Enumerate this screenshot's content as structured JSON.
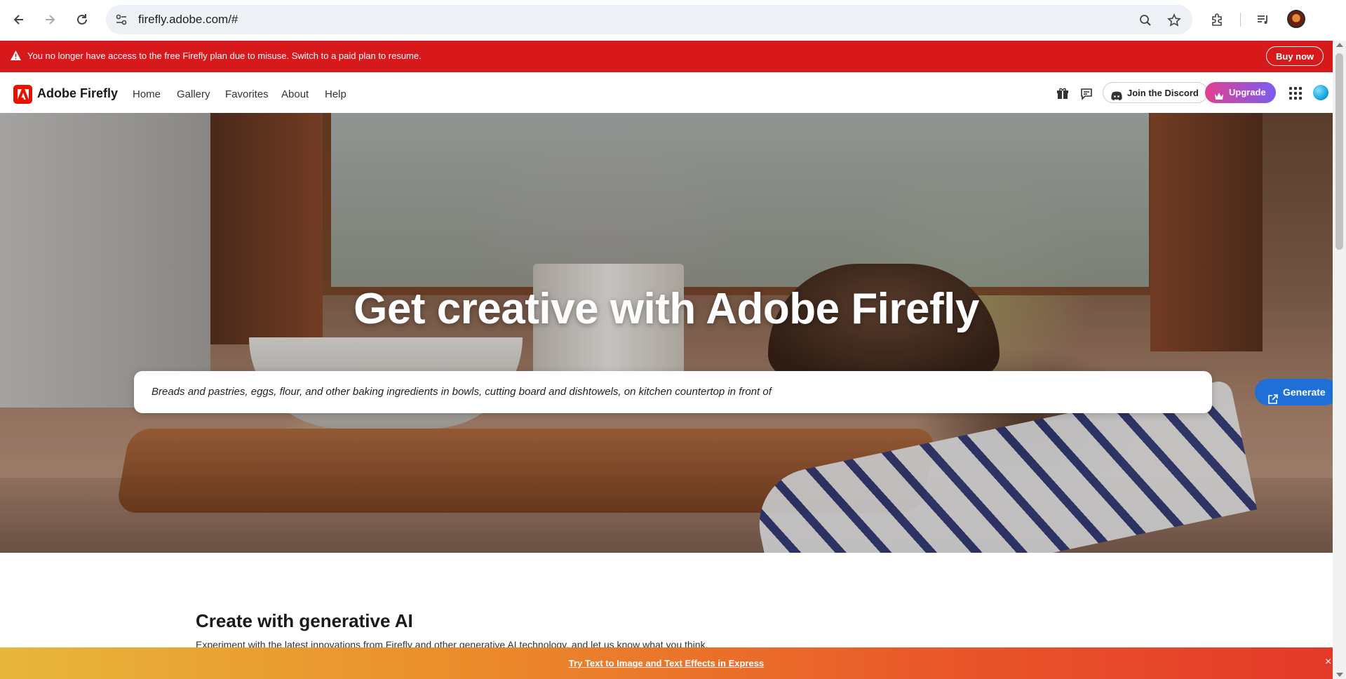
{
  "browser": {
    "url": "firefly.adobe.com/#",
    "icons": [
      "back-arrow-icon",
      "forward-arrow-icon",
      "reload-icon",
      "site-settings-icon",
      "zoom-icon",
      "bookmark-star-icon",
      "extensions-icon",
      "media-control-icon",
      "profile-avatar"
    ]
  },
  "alert": {
    "message": "You no longer have access to the free Firefly plan due to misuse. Switch to a paid plan to resume.",
    "button": "Buy now",
    "color": "#d7191c"
  },
  "header": {
    "brand": "Adobe Firefly",
    "nav": [
      "Home",
      "Gallery",
      "Favorites",
      "About",
      "Help"
    ],
    "discord_label": "Join the Discord",
    "upgrade_label": "Upgrade"
  },
  "hero": {
    "title": "Get creative with Adobe Firefly",
    "prompt": "Breads and pastries, eggs, flour, and other baking ingredients in bowls, cutting board and dishtowels, on kitchen countertop in front of",
    "generate_label": "Generate",
    "accent": "#1f6fd6"
  },
  "section": {
    "title": "Create with generative AI",
    "subtitle": "Experiment with the latest innovations from Firefly and other generative AI technology, and let us know what you think."
  },
  "promo": {
    "link": "Try Text to Image and Text Effects in Express",
    "close": "×"
  }
}
